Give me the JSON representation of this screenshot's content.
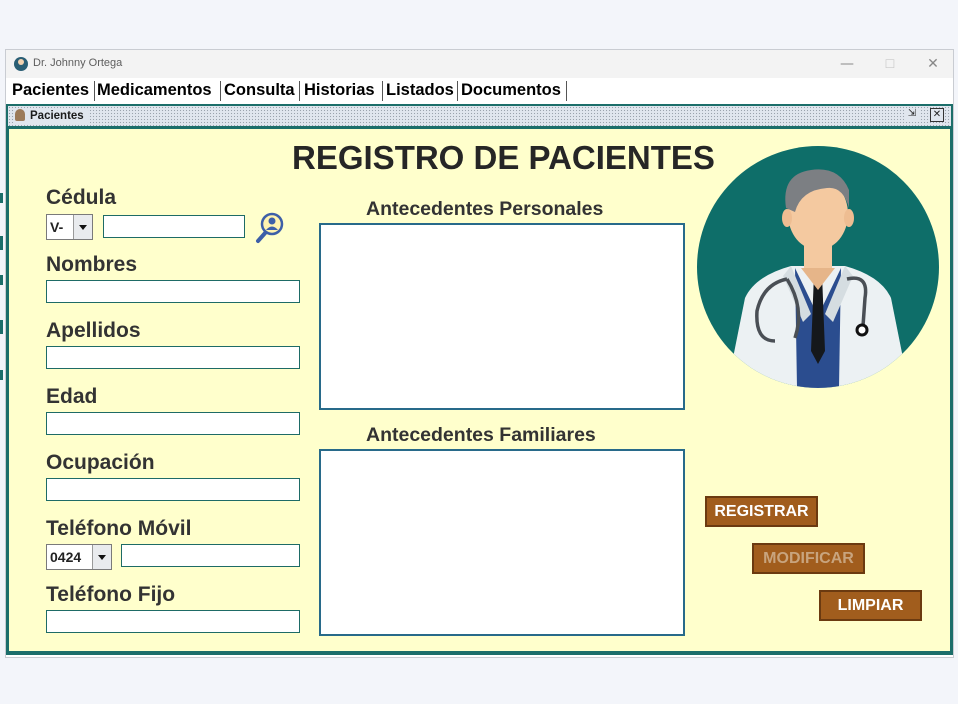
{
  "window": {
    "title": "Dr. Johnny Ortega",
    "controls": {
      "minimize": "—",
      "maximize": "☐",
      "close": "✕"
    }
  },
  "menubar": {
    "items": [
      {
        "label": "Pacientes"
      },
      {
        "label": "Medicamentos"
      },
      {
        "label": "Consulta"
      },
      {
        "label": "Historias"
      },
      {
        "label": "Listados"
      },
      {
        "label": "Documentos"
      }
    ]
  },
  "internal_frame": {
    "title": "Pacientes",
    "controls": {
      "minimize": "⇲",
      "close": "✕"
    }
  },
  "form": {
    "heading": "REGISTRO DE PACIENTES",
    "cedula": {
      "label": "Cédula",
      "prefix": "V-",
      "value": ""
    },
    "nombres": {
      "label": "Nombres",
      "value": ""
    },
    "apellidos": {
      "label": "Apellidos",
      "value": ""
    },
    "edad": {
      "label": "Edad",
      "value": ""
    },
    "ocupacion": {
      "label": "Ocupación",
      "value": ""
    },
    "telefono_movil": {
      "label": "Teléfono Móvil",
      "prefix": "0424",
      "value": ""
    },
    "telefono_fijo": {
      "label": "Teléfono Fijo",
      "value": ""
    },
    "antecedentes_personales": {
      "label": "Antecedentes Personales",
      "value": ""
    },
    "antecedentes_familiares": {
      "label": "Antecedentes Familiares",
      "value": ""
    }
  },
  "buttons": {
    "registrar": {
      "label": "REGISTRAR",
      "text_color": "#ffffff"
    },
    "modificar": {
      "label": "MODIFICAR",
      "text_color": "#c8a47e"
    },
    "limpiar": {
      "label": "LIMPIAR",
      "text_color": "#ffffff"
    }
  },
  "icons": {
    "app": "doctor-avatar-icon",
    "frame": "patient-icon",
    "search": "magnifier-user-icon",
    "illustration": "doctor-illustration"
  },
  "colors": {
    "panel_bg": "#ffffcc",
    "frame_border": "#1c6e6a",
    "button_bg": "#a15d1d",
    "field_border": "#1e6b66",
    "illustration_bg": "#0e6e69"
  }
}
